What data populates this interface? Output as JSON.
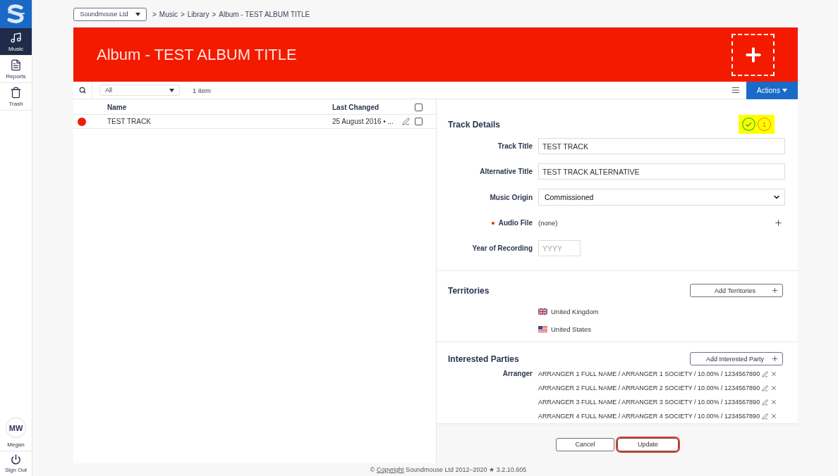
{
  "sidebar": {
    "items": [
      {
        "kind": "music",
        "label": "Music",
        "selected": true
      },
      {
        "kind": "reports",
        "label": "Reports",
        "selected": false
      },
      {
        "kind": "trash",
        "label": "Trash",
        "selected": false
      }
    ],
    "user": {
      "initials": "MW",
      "name": "Megan"
    },
    "sign_out": "Sign Out"
  },
  "breadcrumb": {
    "account": "Soundmouse Ltd",
    "separator": ">",
    "items": [
      "Music",
      "Library",
      "Album - TEST ALBUM TITLE"
    ]
  },
  "header": {
    "title": "Album - TEST ALBUM TITLE"
  },
  "toolbar": {
    "filter": "All",
    "count": "1 item",
    "actions": "Actions"
  },
  "list": {
    "columns": [
      "Name",
      "Last Changed"
    ],
    "select_all": {
      "checked": false
    },
    "rows": [
      {
        "color": "#f41a00",
        "name": "TEST TRACK",
        "last_changed": "25 August 2016 • ...",
        "checked": false
      }
    ]
  },
  "track_details": {
    "title": "Track Details",
    "status": {
      "highlighted": true,
      "issues": "1"
    },
    "fields": [
      {
        "kind": "text",
        "label": "Track Title",
        "required": false,
        "value": "TEST TRACK"
      },
      {
        "kind": "text",
        "label": "Alternative Title",
        "required": false,
        "value": "TEST TRACK ALTERNATIVE"
      },
      {
        "kind": "select",
        "label": "Music Origin",
        "required": false,
        "value": "Commissioned"
      },
      {
        "kind": "file",
        "label": "Audio File",
        "required": true,
        "value": "(none)"
      },
      {
        "kind": "year",
        "label": "Year of Recording",
        "required": false,
        "placeholder": "YYYY"
      }
    ]
  },
  "territories": {
    "title": "Territories",
    "add_label": "Add Territories",
    "items": [
      {
        "kind": "gb",
        "name": "United Kingdom"
      },
      {
        "kind": "us",
        "name": "United States"
      }
    ]
  },
  "interested_parties": {
    "title": "Interested Parties",
    "add_label": "Add Interested Party",
    "groups": [
      {
        "role": "Arranger",
        "entries": [
          "ARRANGER 1 FULL NAME / ARRANGER 1 SOCIETY / 10.00% / 1234567890",
          "ARRANGER 2 FULL NAME / ARRANGER 2 SOCIETY / 10.00% / 1234567890",
          "ARRANGER 3 FULL NAME / ARRANGER 3 SOCIETY / 10.00% / 1234567890",
          "ARRANGER 4 FULL NAME / ARRANGER 4 SOCIETY / 10.00% / 1234567890"
        ]
      }
    ]
  },
  "form_buttons": [
    {
      "label": "Cancel",
      "highlighted": false
    },
    {
      "label": "Update",
      "highlighted": true
    }
  ],
  "footer": {
    "prefix": "©",
    "link": "Copyright",
    "text": "Soundmouse Ltd 2012–2020 ★ 3.2.10.605"
  }
}
